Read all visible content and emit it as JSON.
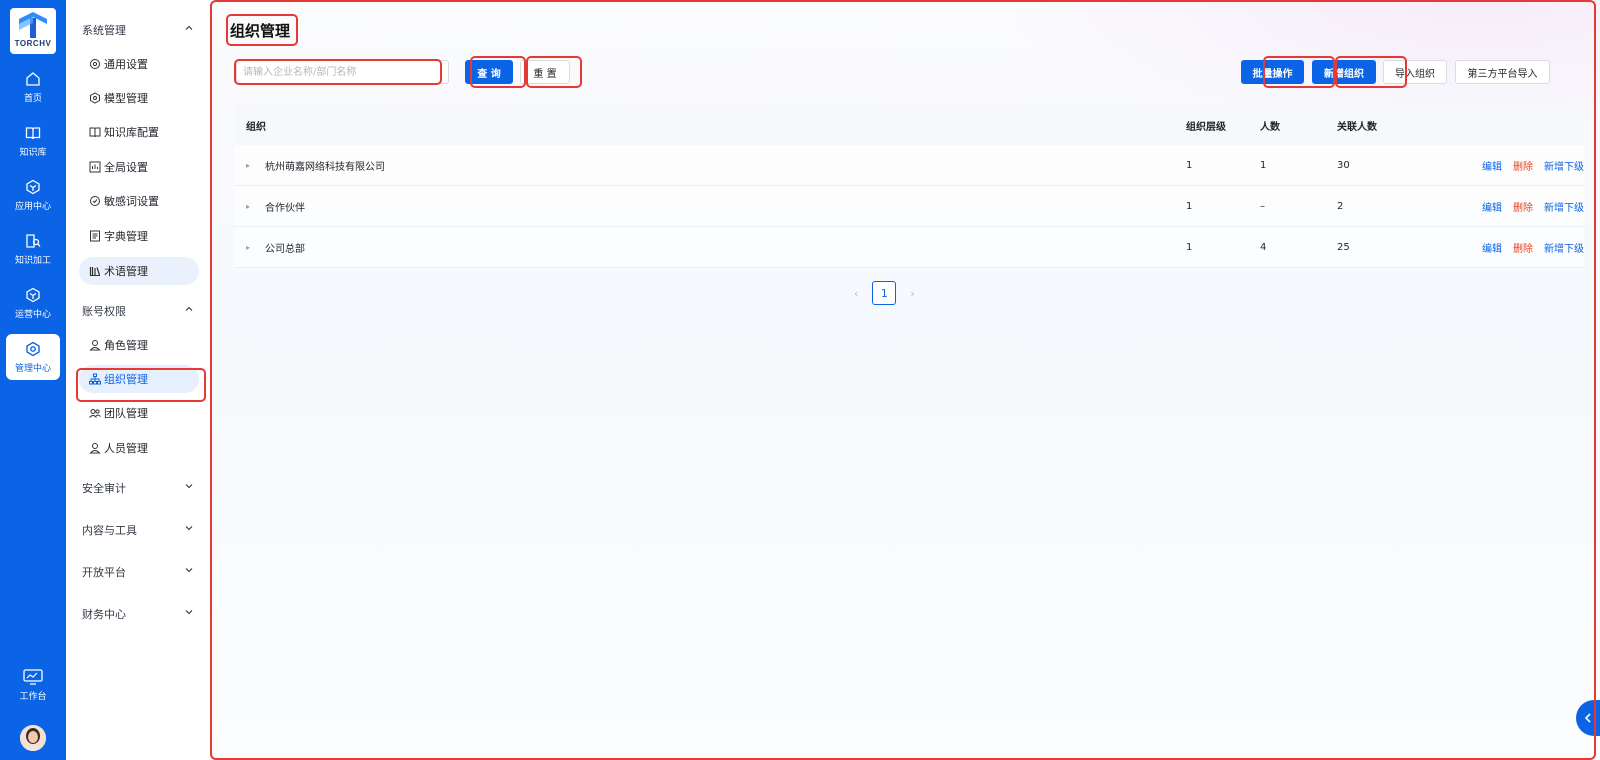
{
  "brand": {
    "logo_text": "TORCHV"
  },
  "rail": {
    "items": [
      {
        "label": "首页",
        "icon": "home-icon"
      },
      {
        "label": "知识库",
        "icon": "book-icon"
      },
      {
        "label": "应用中心",
        "icon": "cube-icon"
      },
      {
        "label": "知识加工",
        "icon": "doc-search-icon"
      },
      {
        "label": "运营中心",
        "icon": "cube-icon"
      },
      {
        "label": "管理中心",
        "icon": "hexagon-gear-icon"
      }
    ],
    "workbench": "工作台"
  },
  "subnav": {
    "system": {
      "title": "系统管理",
      "items": [
        "通用设置",
        "模型管理",
        "知识库配置",
        "全局设置",
        "敏感词设置",
        "字典管理",
        "术语管理"
      ]
    },
    "account": {
      "title": "账号权限",
      "items": [
        "角色管理",
        "组织管理",
        "团队管理",
        "人员管理"
      ]
    },
    "collapsed_groups": [
      "安全审计",
      "内容与工具",
      "开放平台",
      "财务中心"
    ]
  },
  "main": {
    "title": "组织管理",
    "search_placeholder": "请输入企业名称/部门名称",
    "buttons": {
      "query": "查 询",
      "reset": "重 置",
      "batch": "批量操作",
      "add_org": "新增组织",
      "import_org": "导入组织",
      "third_party_import": "第三方平台导入"
    },
    "table": {
      "headers": {
        "org": "组织",
        "level": "组织层级",
        "count": "人数",
        "assoc": "关联人数"
      },
      "rows": [
        {
          "org": "杭州萌嘉网络科技有限公司",
          "level": "1",
          "count": "1",
          "assoc": "30"
        },
        {
          "org": "合作伙伴",
          "level": "1",
          "count": "–",
          "assoc": "2"
        },
        {
          "org": "公司总部",
          "level": "1",
          "count": "4",
          "assoc": "25"
        }
      ],
      "actions": {
        "edit": "编辑",
        "delete": "删除",
        "add_child": "新增下级"
      }
    },
    "pagination": {
      "current": "1"
    }
  },
  "colors": {
    "primary": "#0b64e6",
    "danger": "#e8431e",
    "annotation": "#e53935"
  }
}
